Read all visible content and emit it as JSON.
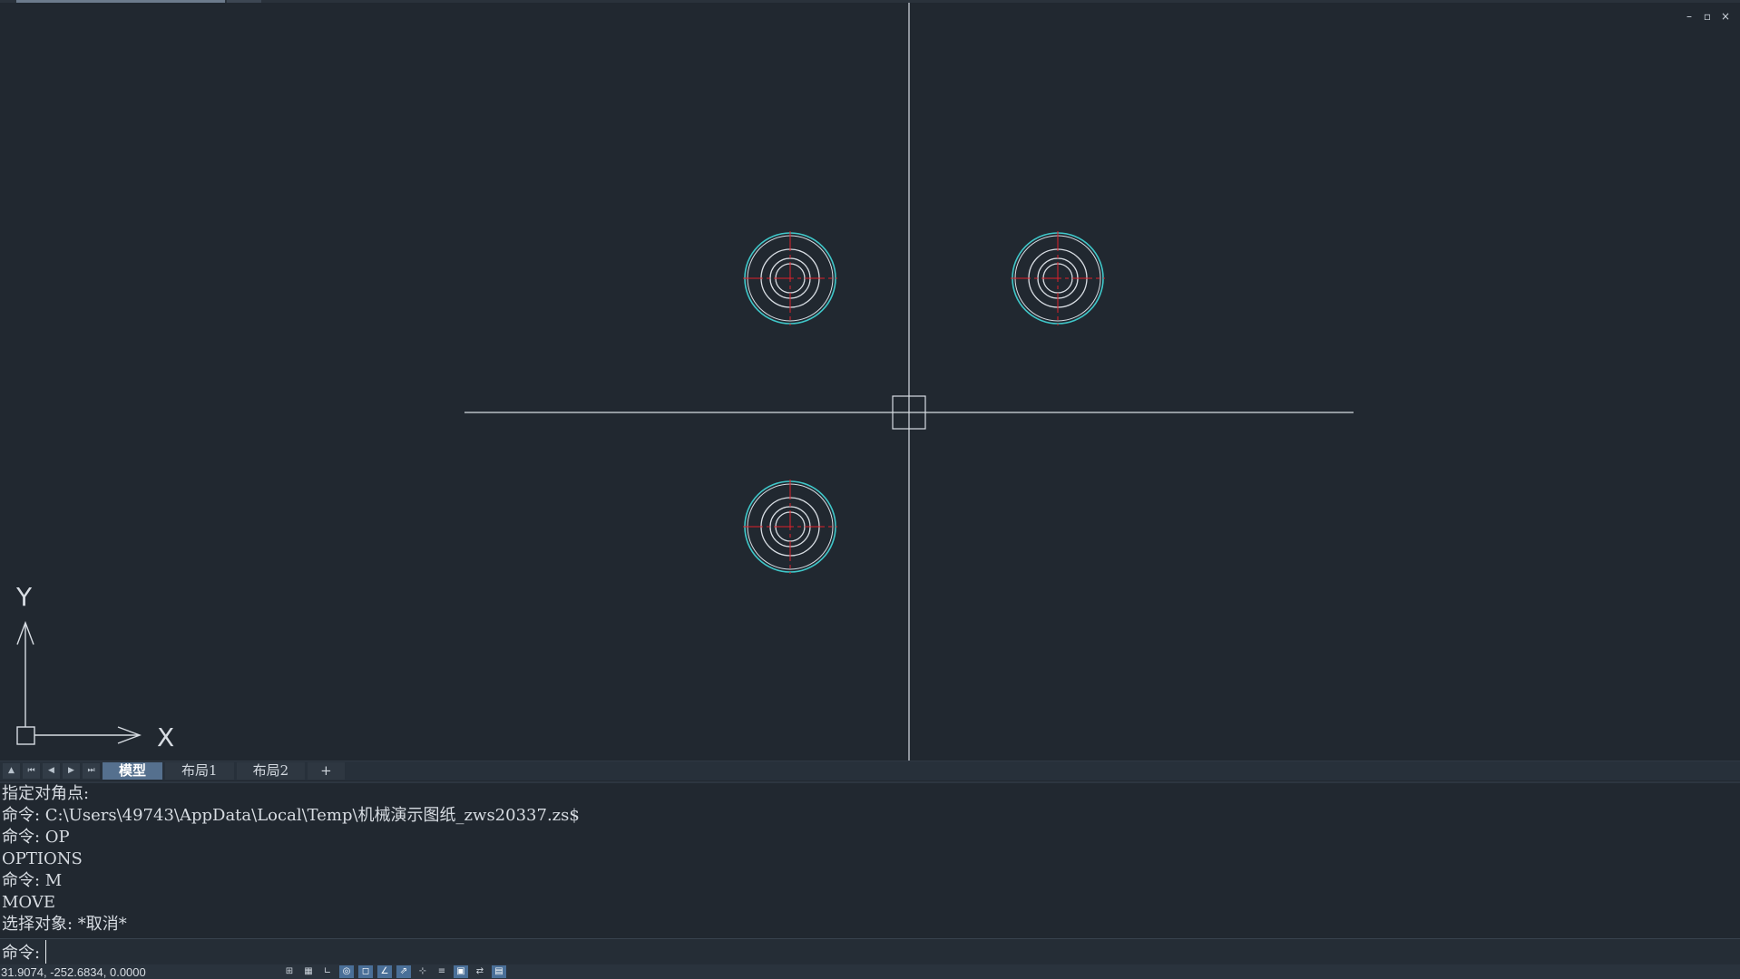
{
  "window_controls": {
    "minimize": "–",
    "restore": "▫",
    "close": "×"
  },
  "ucs": {
    "x_label": "X",
    "y_label": "Y"
  },
  "colors": {
    "background": "#212830",
    "crosshair": "#d8dde3",
    "circle_outer": "#3fc7c9",
    "circle_inner": "#d8dde3",
    "center_mark": "#e0202a"
  },
  "layout_tabs": {
    "nav_icons": [
      "triangle-up-icon",
      "first-icon",
      "prev-icon",
      "next-icon",
      "last-icon"
    ],
    "tabs": [
      {
        "label": "模型",
        "active": true
      },
      {
        "label": "布局1",
        "active": false
      },
      {
        "label": "布局2",
        "active": false
      },
      {
        "label": "+",
        "active": false
      }
    ]
  },
  "command_history": [
    "指定对角点:",
    "命令: C:\\Users\\49743\\AppData\\Local\\Temp\\机械演示图纸_zws20337.zs$",
    "命令: OP",
    "OPTIONS",
    "命令: M",
    "MOVE",
    "选择对象: *取消*"
  ],
  "command_input": {
    "prompt": "命令:",
    "value": ""
  },
  "status_bar": {
    "coordinates": "31.9074, -252.6834, 0.0000",
    "toggles": [
      {
        "icon": "grid-display-icon",
        "on": false
      },
      {
        "icon": "snap-mode-icon",
        "on": false
      },
      {
        "icon": "ortho-icon",
        "on": false
      },
      {
        "icon": "polar-tracking-icon",
        "on": true
      },
      {
        "icon": "object-snap-icon",
        "on": true
      },
      {
        "icon": "osnap-tracking-icon",
        "on": true
      },
      {
        "icon": "dynamic-ucs-icon",
        "on": true
      },
      {
        "icon": "dynamic-input-icon",
        "on": false
      },
      {
        "icon": "lineweight-icon",
        "on": false
      },
      {
        "icon": "transparency-icon",
        "on": true
      },
      {
        "icon": "selection-cycling-icon",
        "on": false
      },
      {
        "icon": "annotation-scale-icon",
        "on": true
      }
    ]
  }
}
